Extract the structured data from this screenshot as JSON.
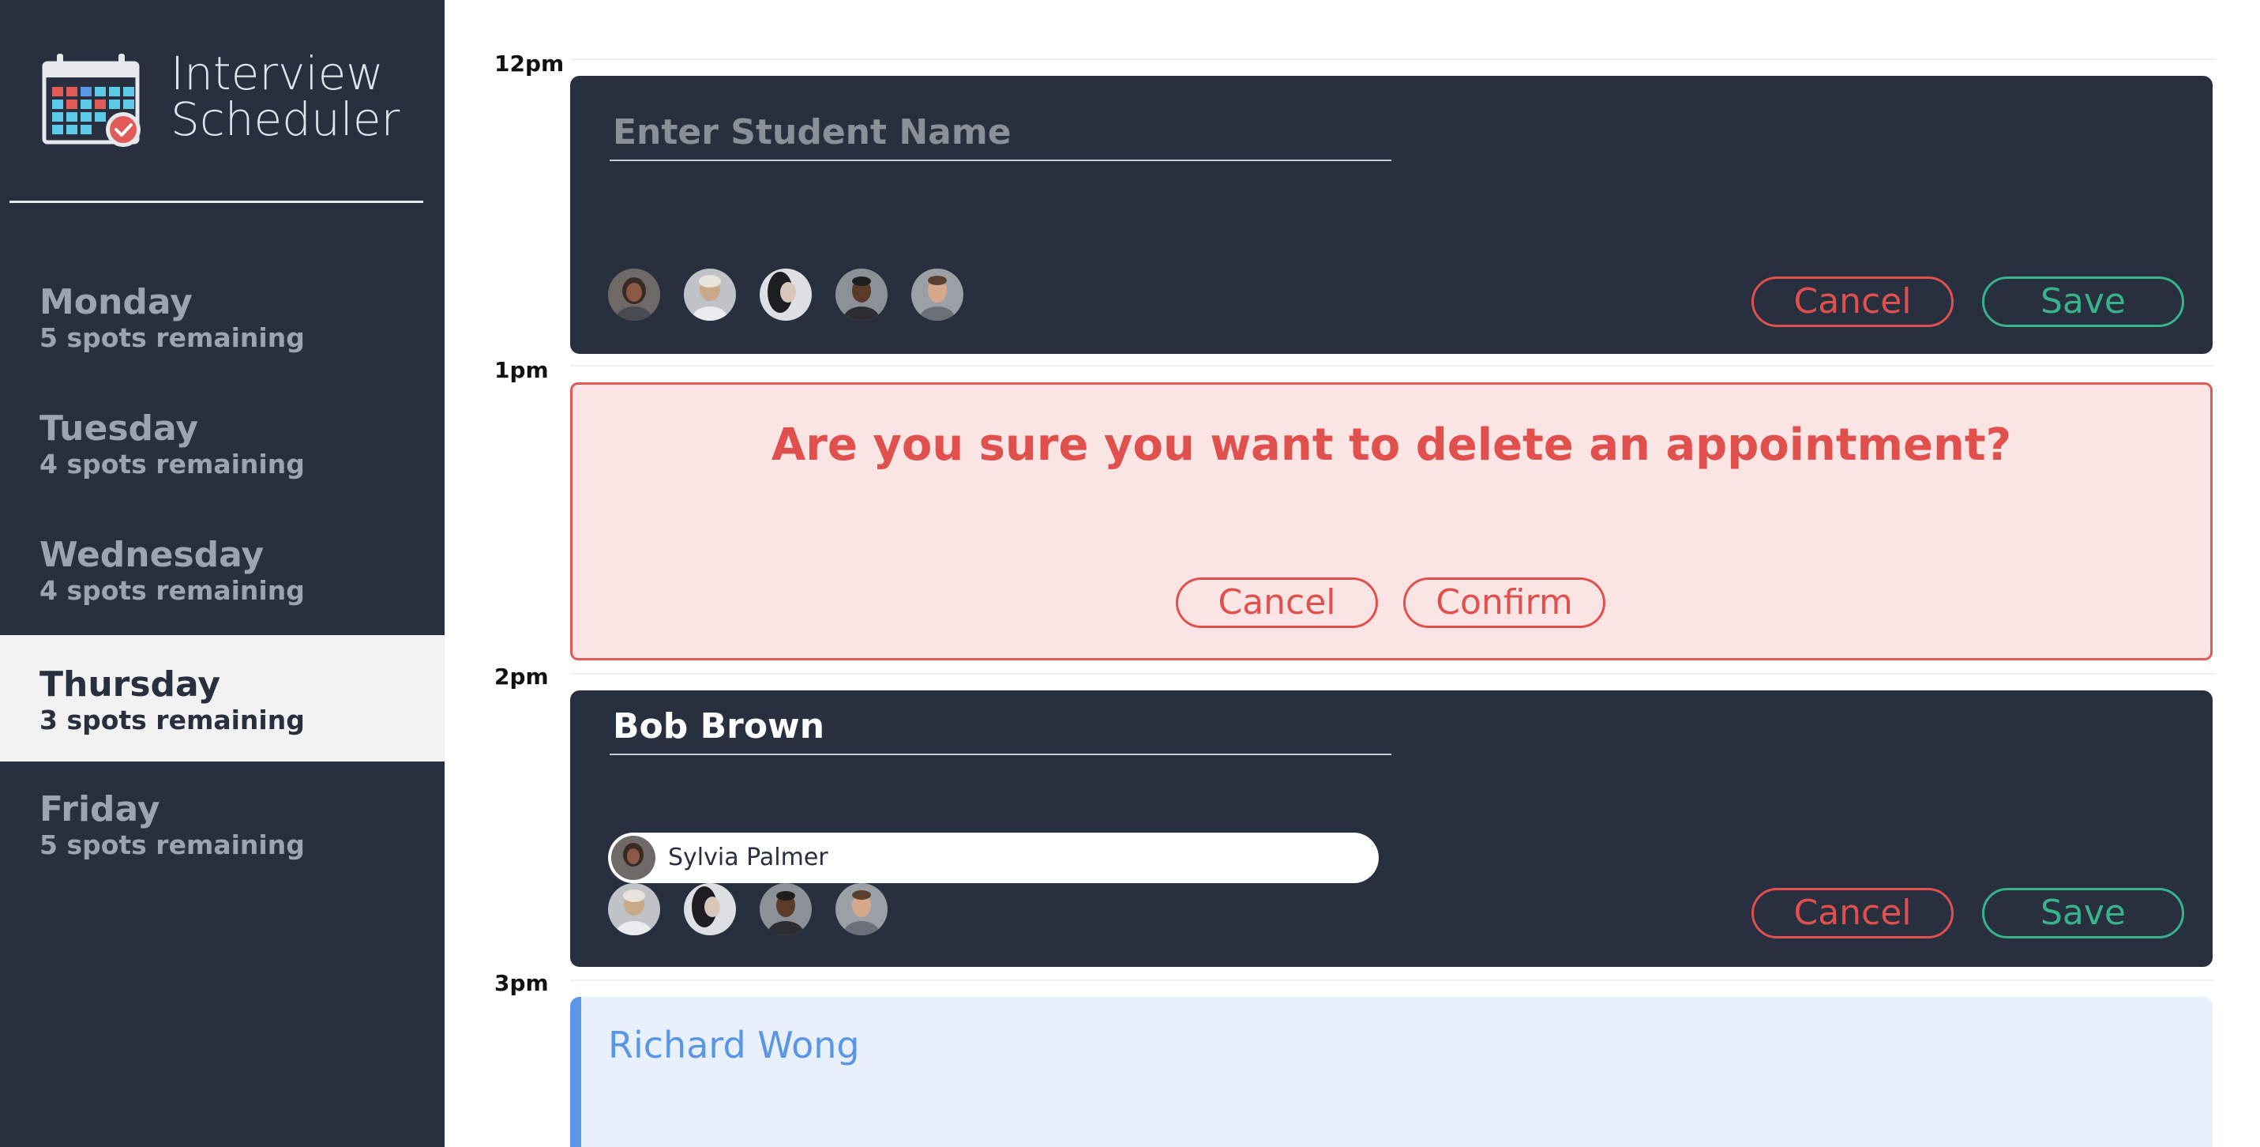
{
  "app": {
    "title_line1": "Interview",
    "title_line2": "Scheduler"
  },
  "colors": {
    "sidebar_bg": "#283040",
    "selected_day_bg": "#f2f2f3",
    "danger": "#e0504d",
    "success": "#38b38a",
    "booked_accent": "#5a95e6",
    "booked_bg": "#e8f0fc",
    "confirm_bg": "#fbe4e4"
  },
  "sidebar": {
    "days": [
      {
        "name": "Monday",
        "spots": "5 spots remaining",
        "selected": false
      },
      {
        "name": "Tuesday",
        "spots": "4 spots remaining",
        "selected": false
      },
      {
        "name": "Wednesday",
        "spots": "4 spots remaining",
        "selected": false
      },
      {
        "name": "Thursday",
        "spots": "3 spots remaining",
        "selected": true
      },
      {
        "name": "Friday",
        "spots": "5 spots remaining",
        "selected": false
      }
    ]
  },
  "schedule": {
    "times": [
      "12pm",
      "1pm",
      "2pm",
      "3pm"
    ],
    "slot_12pm": {
      "placeholder": "Enter Student Name",
      "value": "",
      "cancel_label": "Cancel",
      "save_label": "Save"
    },
    "slot_1pm": {
      "message": "Are you sure you want to delete an appointment?",
      "cancel_label": "Cancel",
      "confirm_label": "Confirm"
    },
    "slot_2pm": {
      "student": "Bob Brown",
      "selected_interviewer": "Sylvia Palmer",
      "cancel_label": "Cancel",
      "save_label": "Save"
    },
    "slot_3pm": {
      "student": "Richard Wong"
    }
  },
  "icons": {
    "logo": "calendar-check-icon",
    "avatar": "interviewer-avatar"
  }
}
